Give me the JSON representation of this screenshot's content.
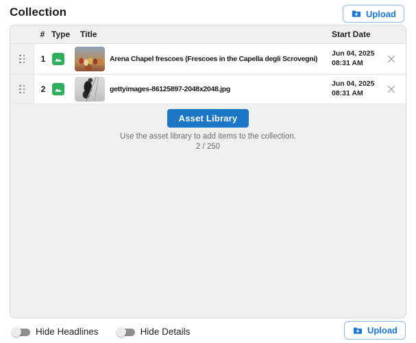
{
  "page_title": "Collection",
  "header": {
    "upload_label": "Upload"
  },
  "table": {
    "headers": {
      "index": "#",
      "type": "Type",
      "title": "Title",
      "start_date": "Start Date"
    },
    "rows": [
      {
        "index": "1",
        "type": "image",
        "title": "Arena Chapel frescoes (Frescoes in the Capella degli Scrovegni)",
        "date": "Jun 04, 2025",
        "time": "08:31 AM"
      },
      {
        "index": "2",
        "type": "image",
        "title": "gettyimages-86125897-2048x2048.jpg",
        "date": "Jun 04, 2025",
        "time": "08:31 AM"
      }
    ]
  },
  "library": {
    "button_label": "Asset Library",
    "hint": "Use the asset library to add items to the collection.",
    "count": "2 / 250"
  },
  "footer": {
    "toggles": [
      {
        "label": "Hide Headlines",
        "state": "off"
      },
      {
        "label": "Hide Details",
        "state": "off"
      }
    ],
    "upload_label": "Upload"
  },
  "icons": {
    "upload": "folder-upload-icon",
    "type_image": "image-icon",
    "drag": "drag-handle-icon",
    "remove": "close-icon"
  },
  "colors": {
    "accent_blue": "#1b76c6",
    "link_blue": "#1976d2",
    "type_green": "#2fae5d",
    "panel_bg": "#f0f0f1",
    "row_bg": "#ffffff",
    "muted_text": "#6f6f6f"
  }
}
